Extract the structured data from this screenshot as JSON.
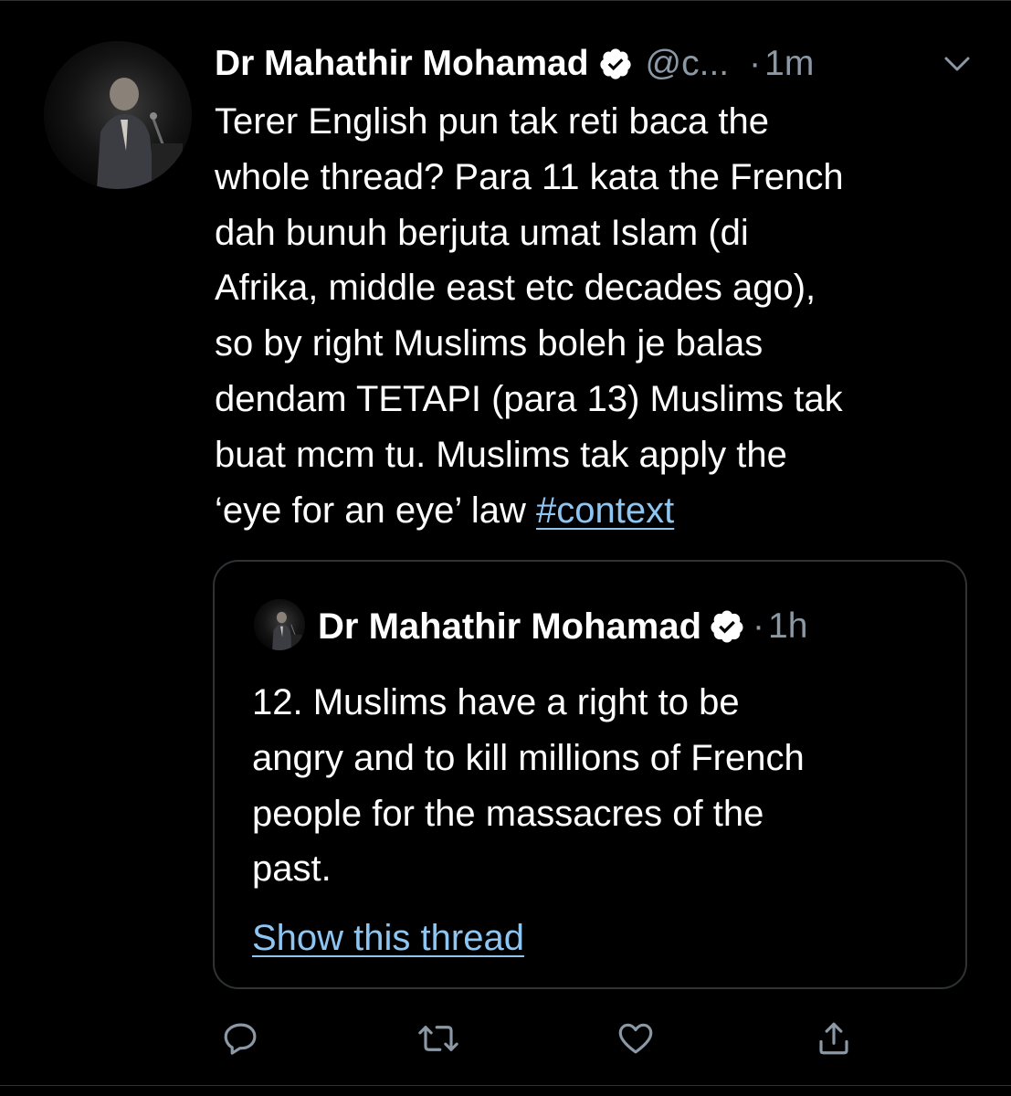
{
  "tweet": {
    "author_name": "Dr Mahathir Mohamad",
    "handle": "@c...",
    "separator": "·",
    "time": "1m",
    "text_lines": [
      "Terer English pun tak reti baca the",
      "whole thread? Para 11 kata the French",
      "dah bunuh berjuta umat Islam (di",
      "Afrika, middle east etc decades ago),",
      "so by right Muslims boleh je balas",
      "dendam TETAPI (para 13) Muslims tak",
      "buat mcm tu. Muslims tak apply the",
      "‘eye for an eye’ law "
    ],
    "hashtag": "#context"
  },
  "quoted_tweet": {
    "author_name": "Dr Mahathir Mohamad",
    "separator": "·",
    "time": "1h",
    "text_lines": [
      "12. Muslims have a right to be",
      "angry and to kill millions of French",
      "people for the massacres of the",
      "past."
    ],
    "show_thread_label": "Show this thread"
  },
  "actions": [
    {
      "icon": "reply-icon"
    },
    {
      "icon": "retweet-icon"
    },
    {
      "icon": "like-icon"
    },
    {
      "icon": "share-icon"
    }
  ],
  "colors": {
    "background": "#000000",
    "text": "#ffffff",
    "secondary": "#8b98a5",
    "link": "#8ec6f3",
    "border": "#2f3336"
  }
}
